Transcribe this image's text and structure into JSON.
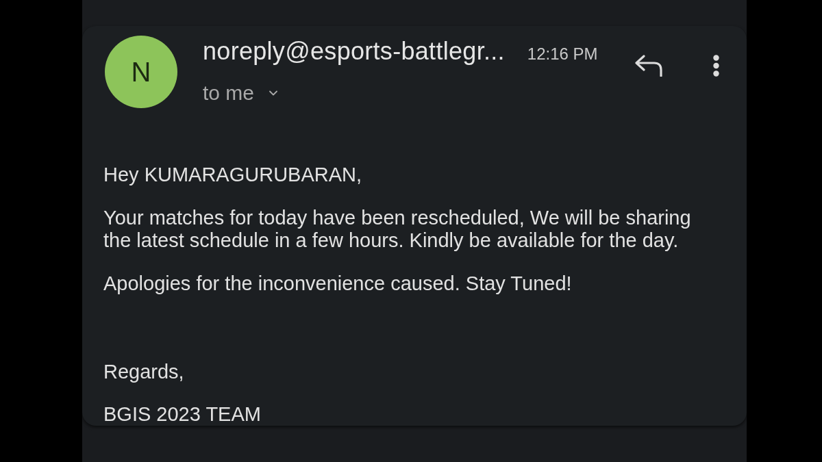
{
  "message": {
    "avatar": {
      "letter": "N"
    },
    "sender": "noreply@esports-battlegr...",
    "time": "12:16 PM",
    "recipient": "to me",
    "body": [
      "Hey KUMARAGURUBARAN,",
      "Your matches for today have been rescheduled, We will be sharing the latest schedule in a few hours. Kindly be available for the day.",
      "Apologies for the inconvenience caused. Stay Tuned!"
    ],
    "closing": [
      "Regards,",
      "BGIS 2023 TEAM"
    ]
  }
}
